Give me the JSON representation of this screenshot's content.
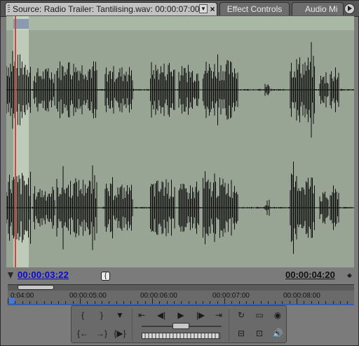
{
  "tabs": {
    "source_label": "Source: Radio Trailer: Tantilising.wav: 00:00:07:00",
    "menu_glyph": "▼",
    "close_glyph": "×",
    "effect_controls": "Effect Controls",
    "audio_mixer": "Audio Mi"
  },
  "timecode": {
    "current": "00:00:03:22",
    "duration": "00:00:04:20"
  },
  "ruler": {
    "labels": [
      "0:04:00",
      "00:00:05:00",
      "00:00:06:00",
      "00:00:07:00",
      "00:00:08:00"
    ]
  },
  "colors": {
    "waveform_bg": "#99a594",
    "playhead": "#c64a3f",
    "current_timecode": "#0a0ac8"
  },
  "icons": {
    "mark_in": "mark-in-icon",
    "mark_out": "mark-out-icon",
    "set_marker": "set-marker-icon",
    "step_back": "step-back-icon",
    "play": "play-icon",
    "step_forward": "step-forward-icon",
    "loop": "loop-icon",
    "safe_margins": "safe-margins-icon",
    "output": "output-icon",
    "insert": "insert-icon",
    "overlay": "overlay-icon",
    "audio": "speaker-icon"
  }
}
